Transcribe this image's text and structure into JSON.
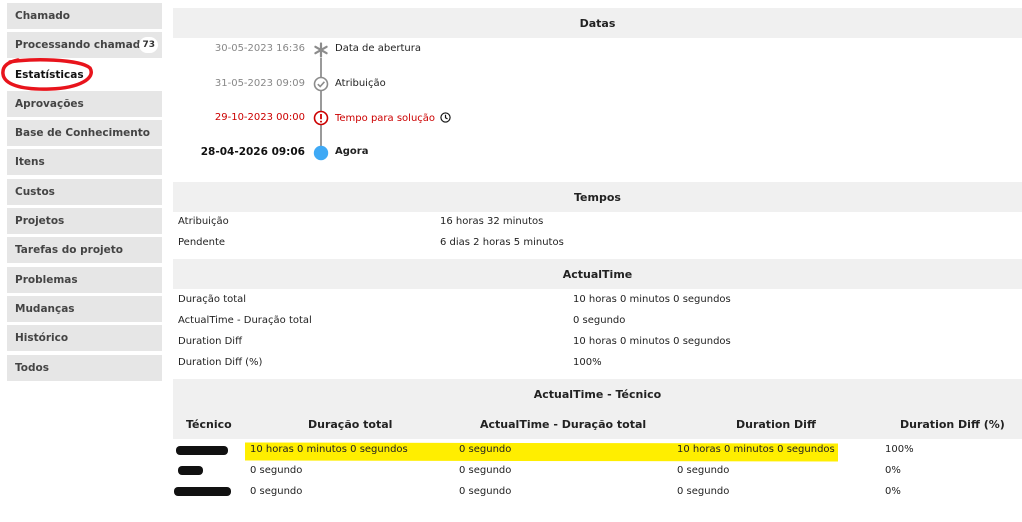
{
  "sidebar": {
    "items": [
      {
        "label": "Chamado"
      },
      {
        "label": "Processando chamado",
        "badge": "73"
      },
      {
        "label": "Estatísticas",
        "active": true
      },
      {
        "label": "Aprovações"
      },
      {
        "label": "Base de Conhecimento"
      },
      {
        "label": "Itens"
      },
      {
        "label": "Custos"
      },
      {
        "label": "Projetos"
      },
      {
        "label": "Tarefas do projeto"
      },
      {
        "label": "Problemas"
      },
      {
        "label": "Mudanças"
      },
      {
        "label": "Histórico"
      },
      {
        "label": "Todos"
      }
    ]
  },
  "datas": {
    "title": "Datas",
    "timeline": [
      {
        "date": "30-05-2023 16:36",
        "label": "Data de abertura",
        "icon": "asterisk-icon"
      },
      {
        "date": "31-05-2023 09:09",
        "label": "Atribuição",
        "icon": "check-circle-icon"
      },
      {
        "date": "29-10-2023 00:00",
        "label": "Tempo para solução",
        "icon": "alert-circle-icon",
        "extra_icon": "clock-icon"
      },
      {
        "date": "28-04-2026 09:06",
        "label": "Agora",
        "icon": "now-dot-icon"
      }
    ]
  },
  "tempos": {
    "title": "Tempos",
    "rows": [
      {
        "label": "Atribuição",
        "value": "16 horas 32 minutos"
      },
      {
        "label": "Pendente",
        "value": "6 dias 2 horas 5 minutos"
      }
    ]
  },
  "actualtime": {
    "title": "ActualTime",
    "rows": [
      {
        "label": "Duração total",
        "value": "10 horas 0 minutos 0 segundos"
      },
      {
        "label": "ActualTime - Duração total",
        "value": "0 segundo"
      },
      {
        "label": "Duration Diff",
        "value": "10 horas 0 minutos 0 segundos"
      },
      {
        "label": "Duration Diff (%)",
        "value": "100%"
      }
    ]
  },
  "tecnico": {
    "title": "ActualTime - Técnico",
    "headers": [
      "Técnico",
      "Duração total",
      "ActualTime - Duração total",
      "Duration Diff",
      "Duration Diff (%)"
    ],
    "rows": [
      {
        "duracao": "10 horas 0 minutos 0 segundos",
        "actual": "0 segundo",
        "diff": "10 horas 0 minutos 0 segundos",
        "pct": "100%"
      },
      {
        "duracao": "0 segundo",
        "actual": "0 segundo",
        "diff": "0 segundo",
        "pct": "0%"
      },
      {
        "duracao": "0 segundo",
        "actual": "0 segundo",
        "diff": "0 segundo",
        "pct": "0%"
      }
    ]
  },
  "colors": {
    "annotation_red": "#e8141c",
    "highlight_yellow": "#ffee00",
    "alert_red": "#cc0000",
    "now_blue": "#3fa9f5"
  }
}
